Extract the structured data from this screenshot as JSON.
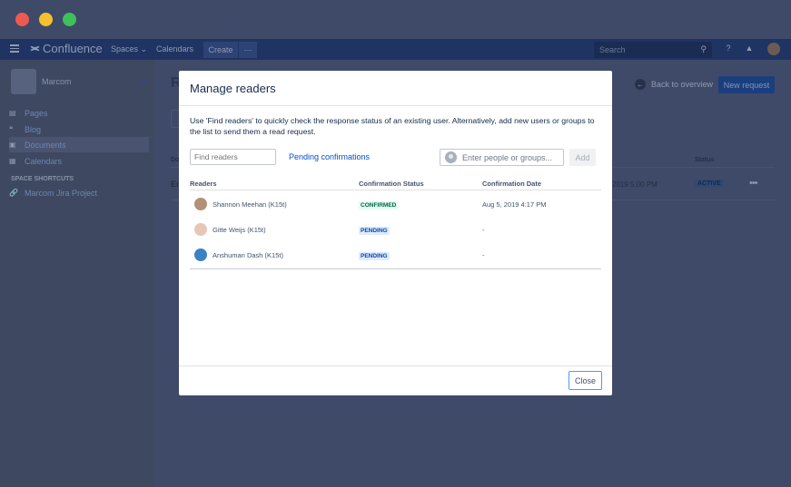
{
  "nav": {
    "brand": "Confluence",
    "spaces": "Spaces",
    "calendars": "Calendars",
    "create": "Create",
    "more": "···",
    "search_placeholder": "Search"
  },
  "sidebar": {
    "space_name": "Marcom",
    "items": [
      {
        "label": "Pages",
        "icon": "pages-icon"
      },
      {
        "label": "Blog",
        "icon": "quote-icon"
      },
      {
        "label": "Documents",
        "icon": "documents-icon"
      },
      {
        "label": "Calendars",
        "icon": "calendar-icon"
      }
    ],
    "shortcuts_heading": "SPACE SHORTCUTS",
    "shortcuts": [
      {
        "label": "Marcom Jira Project",
        "icon": "link-icon"
      }
    ]
  },
  "background_page": {
    "title_fragment": "R",
    "back_label": "Back to overview",
    "new_request_label": "New request",
    "column_fragment": "Do",
    "status_header": "Status",
    "row_fragment": "En",
    "row_date_fragment": "2019 5:00 PM",
    "row_status": "ACTIVE"
  },
  "modal": {
    "title": "Manage readers",
    "description": "Use 'Find readers' to quickly check the response status of an existing user. Alternatively, add new users or groups to the list to send them a read request.",
    "find_placeholder": "Find readers",
    "pending_link": "Pending confirmations",
    "people_placeholder": "Enter people or groups...",
    "add_label": "Add",
    "columns": {
      "readers": "Readers",
      "status": "Confirmation Status",
      "date": "Confirmation Date"
    },
    "rows": [
      {
        "name": "Shannon Meehan (K15t)",
        "status": "CONFIRMED",
        "date": "Aug 5, 2019 4:17 PM"
      },
      {
        "name": "Gitte Weijs (K15t)",
        "status": "PENDING",
        "date": "-"
      },
      {
        "name": "Anshuman Dash (K15t)",
        "status": "PENDING",
        "date": "-"
      }
    ],
    "close_label": "Close"
  },
  "colors": {
    "accent": "#0052cc",
    "confirmed_bg": "#e3fcef",
    "confirmed_fg": "#006644",
    "pending_bg": "#deebff",
    "pending_fg": "#0747a6"
  }
}
